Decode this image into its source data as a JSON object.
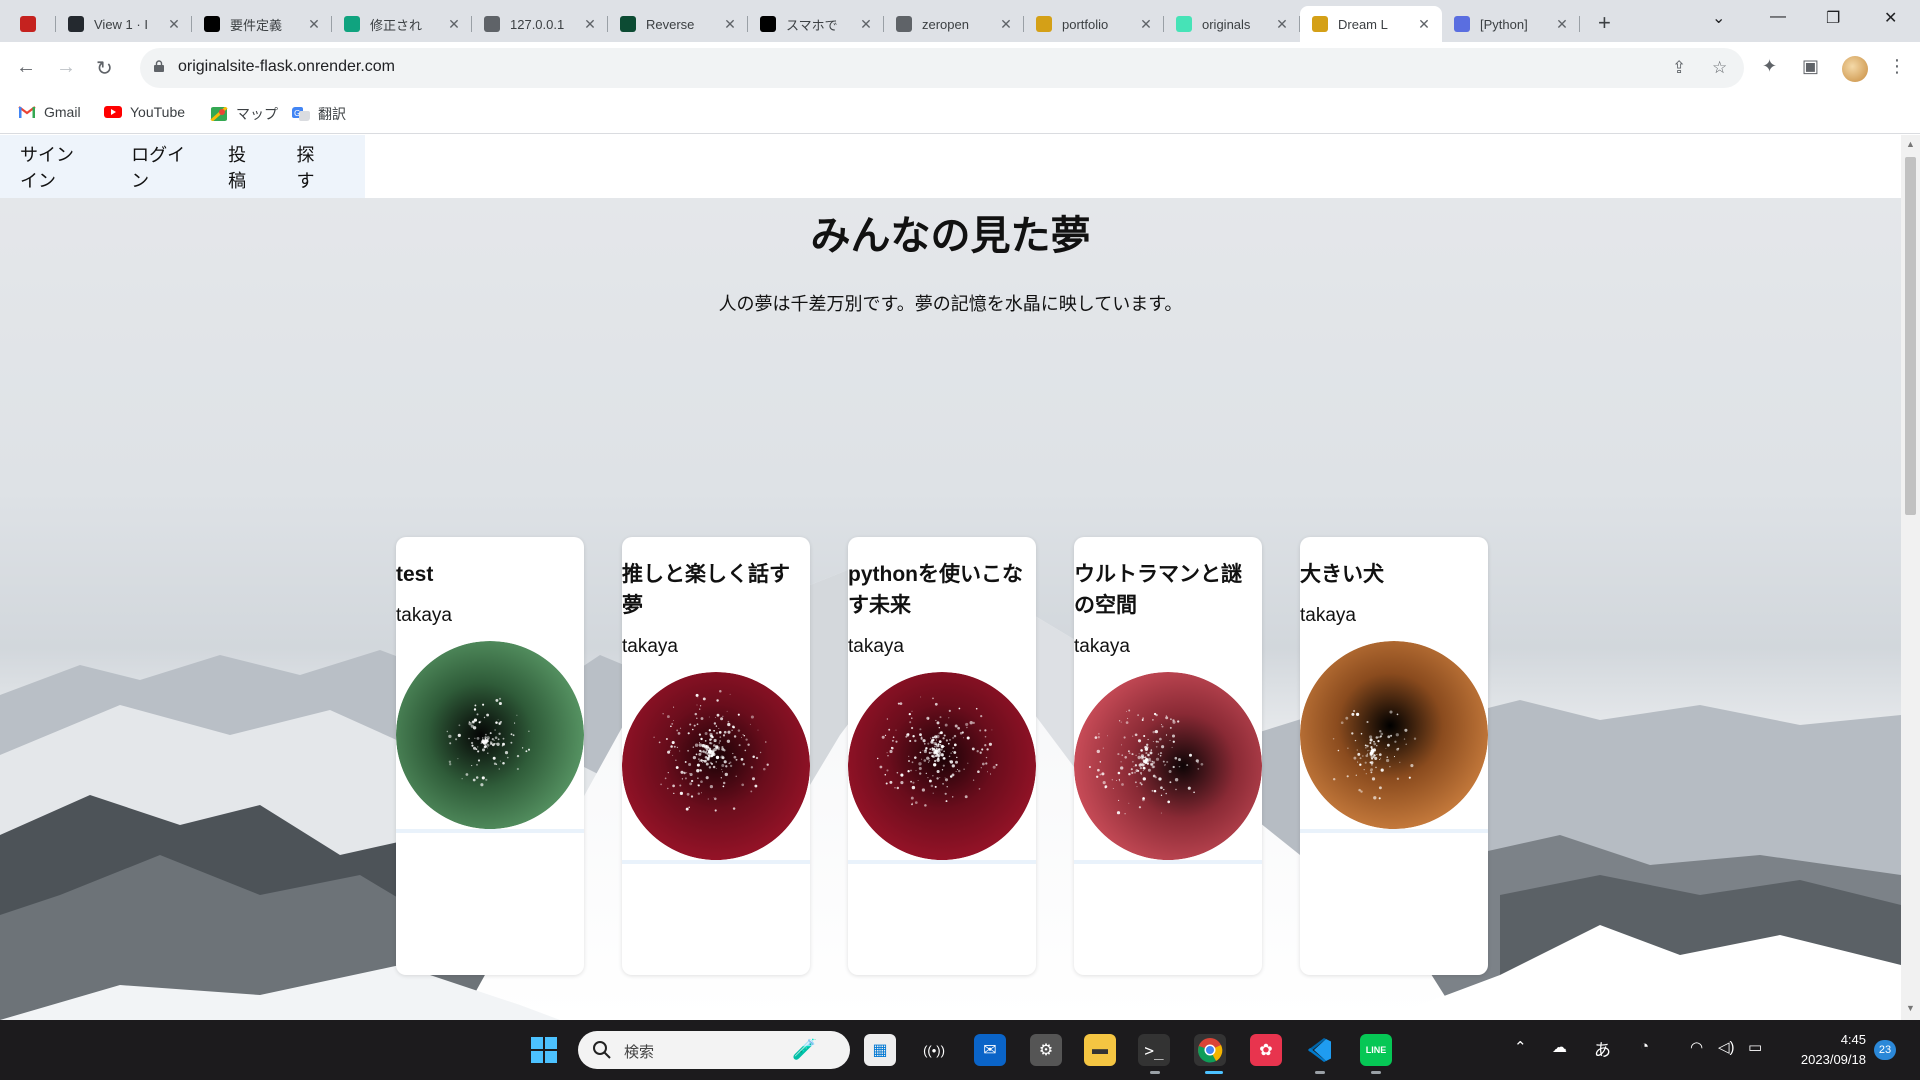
{
  "browser": {
    "tabs": [
      {
        "title": "",
        "icon": "book-icon",
        "color": "#c5221f"
      },
      {
        "title": "View 1 · I",
        "icon": "github-icon",
        "color": "#24292f"
      },
      {
        "title": "要件定義",
        "icon": "notion-icon",
        "color": "#000000"
      },
      {
        "title": "修正され",
        "icon": "chatgpt-icon",
        "color": "#10a37f"
      },
      {
        "title": "127.0.0.1",
        "icon": "globe-icon",
        "color": "#5f6368"
      },
      {
        "title": "Reverse",
        "icon": "django-icon",
        "color": "#0c4b33"
      },
      {
        "title": "スマホで",
        "icon": "ten-icon",
        "color": "#000000"
      },
      {
        "title": "zeropen",
        "icon": "globe-icon",
        "color": "#5f6368"
      },
      {
        "title": "portfolio",
        "icon": "coin-icon",
        "color": "#d4a017"
      },
      {
        "title": "originals",
        "icon": "render-icon",
        "color": "#46e3b7"
      },
      {
        "title": "Dream L",
        "icon": "coin-icon",
        "color": "#d4a017"
      },
      {
        "title": "[Python]",
        "icon": "qiita-icon",
        "color": "#5a6ee0"
      }
    ],
    "url": "originalsite-flask.onrender.com",
    "bookmarks": [
      {
        "label": "Gmail",
        "icon": "gmail-icon"
      },
      {
        "label": "YouTube",
        "icon": "youtube-icon"
      },
      {
        "label": "マップ",
        "icon": "maps-icon"
      },
      {
        "label": "翻訳",
        "icon": "translate-icon"
      }
    ]
  },
  "site": {
    "nav": [
      "サインイン",
      "ログイン",
      "投稿",
      "探す"
    ],
    "title": "みんなの見た夢",
    "subtitle": "人の夢は千差万別です。夢の記憶を水晶に映しています。",
    "dreams": [
      {
        "title": "test",
        "user": "takaya",
        "outer": "#5fa06c",
        "mid": "#2f5c39",
        "core": "#050505",
        "sparkle": "#ffffff"
      },
      {
        "title": "推しと楽しく話す夢",
        "user": "takaya",
        "outer": "#a0142a",
        "mid": "#6a0d1c",
        "core": "#1a0206",
        "sparkle": "#ffffff"
      },
      {
        "title": "pythonを使いこなす未来",
        "user": "takaya",
        "outer": "#a0142a",
        "mid": "#6a0d1c",
        "core": "#1a0206",
        "sparkle": "#ffffff"
      },
      {
        "title": "ウルトラマンと謎の空間",
        "user": "takaya",
        "outer": "#d0505c",
        "mid": "#8a2a35",
        "core": "#0e0506",
        "sparkle": "#ffffff"
      },
      {
        "title": "大きい犬",
        "user": "takaya",
        "outer": "#d28442",
        "mid": "#8a4b1e",
        "core": "#000000",
        "sparkle": "#ffffff"
      }
    ]
  },
  "taskbar": {
    "search_placeholder": "検索",
    "ime": "あ",
    "time": "4:45",
    "date": "2023/09/18",
    "notifications": "23"
  }
}
